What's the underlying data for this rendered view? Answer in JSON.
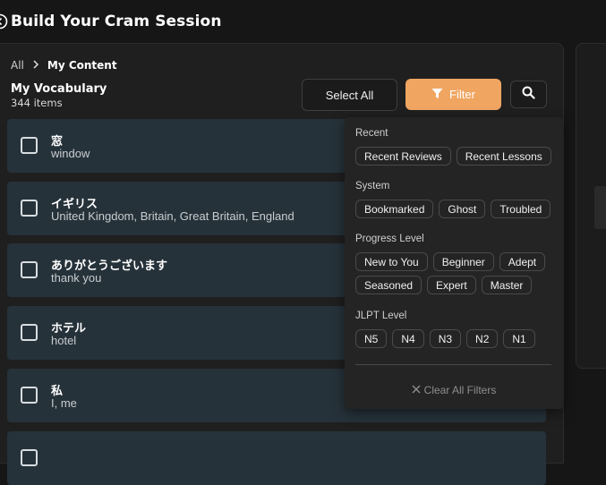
{
  "header": {
    "title": "Build Your Cram Session",
    "back_icon": "back-arrow-icon"
  },
  "breadcrumb": {
    "root": "All",
    "separator_icon": "chevron-right-icon",
    "current": "My Content"
  },
  "list": {
    "title": "My Vocabulary",
    "count": "344 items"
  },
  "toolbar": {
    "select_all_label": "Select All",
    "filter_label": "Filter",
    "filter_icon": "funnel-icon",
    "search_icon": "search-icon",
    "accent_color": "#f0a561"
  },
  "vocab_items": [
    {
      "word": "窓",
      "meaning": "window"
    },
    {
      "word": "イギリス",
      "meaning": "United Kingdom, Britain, Great Britain, England"
    },
    {
      "word": "ありがとうございます",
      "meaning": "thank you"
    },
    {
      "word": "ホテル",
      "meaning": "hotel"
    },
    {
      "word": "私",
      "meaning": "I, me"
    },
    {
      "word": "",
      "meaning": ""
    }
  ],
  "filter_panel": {
    "sections": [
      {
        "label": "Recent",
        "chips": [
          "Recent Reviews",
          "Recent Lessons"
        ]
      },
      {
        "label": "System",
        "chips": [
          "Bookmarked",
          "Ghost",
          "Troubled"
        ]
      },
      {
        "label": "Progress Level",
        "chips": [
          "New to You",
          "Beginner",
          "Adept",
          "Seasoned",
          "Expert",
          "Master"
        ]
      },
      {
        "label": "JLPT Level",
        "chips": [
          "N5",
          "N4",
          "N3",
          "N2",
          "N1"
        ]
      }
    ],
    "clear_label": "Clear All Filters",
    "clear_icon": "close-icon"
  }
}
